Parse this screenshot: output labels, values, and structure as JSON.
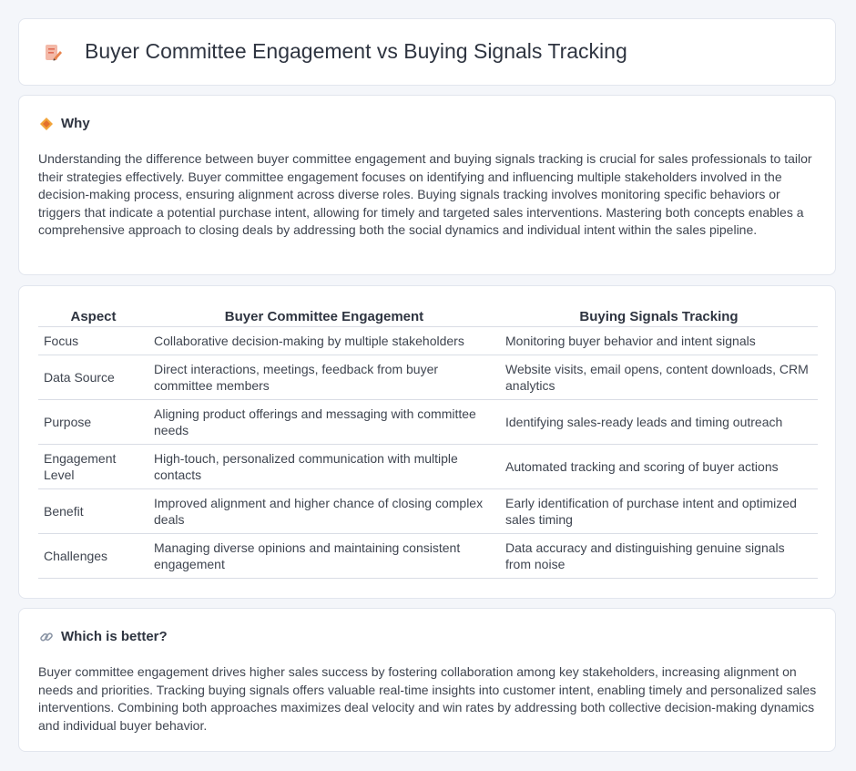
{
  "header": {
    "title": "Buyer Committee Engagement vs Buying Signals Tracking",
    "icon": "document-pencil-icon"
  },
  "why": {
    "title": "Why",
    "icon": "diamond-icon",
    "text": "Understanding the difference between buyer committee engagement and buying signals tracking is crucial for sales professionals to tailor their strategies effectively. Buyer committee engagement focuses on identifying and influencing multiple stakeholders involved in the decision-making process, ensuring alignment across diverse roles. Buying signals tracking involves monitoring specific behaviors or triggers that indicate a potential purchase intent, allowing for timely and targeted sales interventions. Mastering both concepts enables a comprehensive approach to closing deals by addressing both the social dynamics and individual intent within the sales pipeline."
  },
  "table": {
    "headers": [
      "Aspect",
      "Buyer Committee Engagement",
      "Buying Signals Tracking"
    ],
    "rows": [
      [
        "Focus",
        "Collaborative decision-making by multiple stakeholders",
        "Monitoring buyer behavior and intent signals"
      ],
      [
        "Data Source",
        "Direct interactions, meetings, feedback from buyer committee members",
        "Website visits, email opens, content downloads, CRM analytics"
      ],
      [
        "Purpose",
        "Aligning product offerings and messaging with committee needs",
        "Identifying sales-ready leads and timing outreach"
      ],
      [
        "Engagement Level",
        "High-touch, personalized communication with multiple contacts",
        "Automated tracking and scoring of buyer actions"
      ],
      [
        "Benefit",
        "Improved alignment and higher chance of closing complex deals",
        "Early identification of purchase intent and optimized sales timing"
      ],
      [
        "Challenges",
        "Managing diverse opinions and maintaining consistent engagement",
        "Data accuracy and distinguishing genuine signals from noise"
      ]
    ]
  },
  "better": {
    "title": "Which is better?",
    "icon": "link-icon",
    "text": "Buyer committee engagement drives higher sales success by fostering collaboration among key stakeholders, increasing alignment on needs and priorities. Tracking buying signals offers valuable real-time insights into customer intent, enabling timely and personalized sales interventions. Combining both approaches maximizes deal velocity and win rates by addressing both collective decision-making dynamics and individual buyer behavior."
  }
}
